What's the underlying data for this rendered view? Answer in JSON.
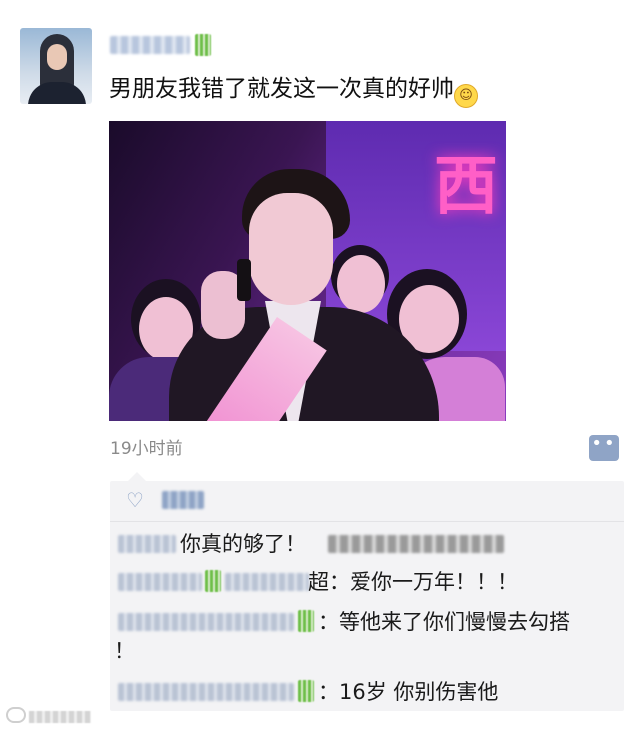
{
  "post": {
    "text": "男朋友我错了就发这一次真的好帅",
    "emoji_icon": "smile-emoji",
    "timestamp": "19小时前",
    "more_icon": "more-dots-icon",
    "more_glyph": "••"
  },
  "comments": {
    "like_icon": "heart-icon",
    "items": [
      {
        "text": "你真的够了！"
      },
      {
        "text": "超：爱你一万年！！！"
      },
      {
        "text": "：等他来了你们慢慢去勾搭",
        "text_cont": "！"
      },
      {
        "text": "：16岁 你别伤害他"
      }
    ]
  }
}
